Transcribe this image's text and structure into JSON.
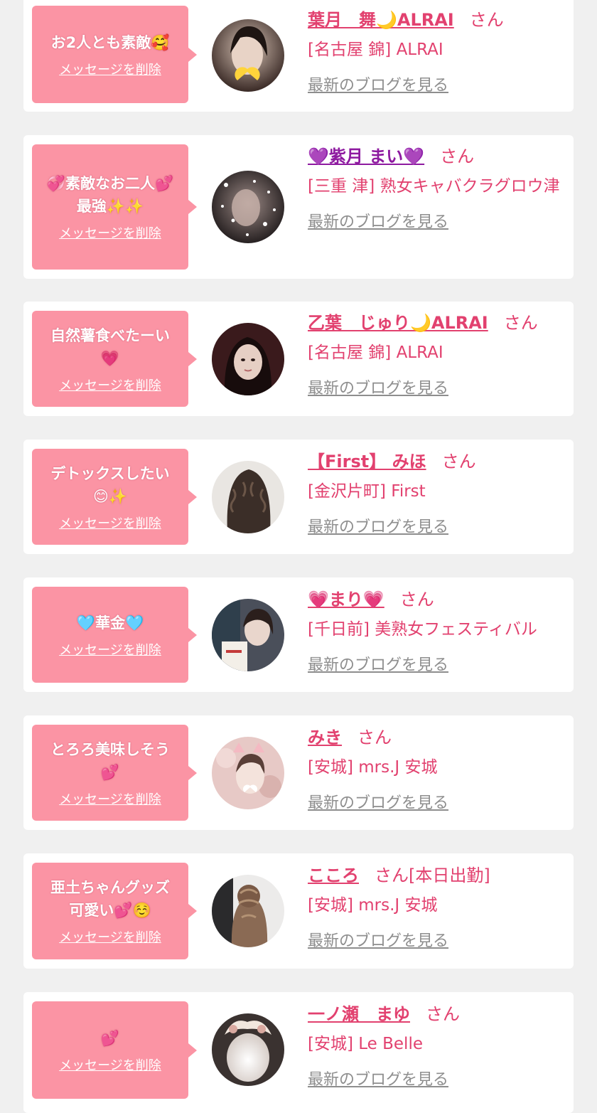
{
  "delete_label": "メッセージを削除",
  "san_label": "さん",
  "blog_label": "最新のブログを見る",
  "colors": {
    "accent": "#e2416f",
    "bubble": "#fb94a4",
    "link_gray": "#8e8e8e",
    "background": "#f0f0f0"
  },
  "entries": [
    {
      "message": "お2人とも素敵🥰",
      "cast_name": "葉月　舞🌙ALRAI",
      "shop": "[名古屋 錦] ALRAI",
      "extra": ""
    },
    {
      "message": "💞素敵なお二人💕\n最強✨✨",
      "cast_name": "💜紫月 まい💜",
      "shop": "[三重 津] 熟女キャバクラグロウ津",
      "extra": ""
    },
    {
      "message": "自然薯食べたーい\n💗",
      "cast_name": "乙葉　じゅり🌙ALRAI",
      "shop": "[名古屋 錦] ALRAI",
      "extra": ""
    },
    {
      "message": "デトックスしたい\n😊✨",
      "cast_name": "【First】 みほ",
      "shop": "[金沢片町] First",
      "extra": ""
    },
    {
      "message": "🩵華金🩵",
      "cast_name": "💗まり💗",
      "shop": "[千日前] 美熟女フェスティバル",
      "extra": ""
    },
    {
      "message": "とろろ美味しそう\n💕",
      "cast_name": "みき",
      "shop": "[安城] mrs.J 安城",
      "extra": ""
    },
    {
      "message": "亜土ちゃんグッズ\n可愛い💕☺️",
      "cast_name": "こころ",
      "shop": "[安城] mrs.J 安城",
      "extra": "[本日出勤]"
    },
    {
      "message": "💕",
      "cast_name": "一ノ瀬　まゆ",
      "shop": "[安城] Le Belle",
      "extra": ""
    }
  ]
}
